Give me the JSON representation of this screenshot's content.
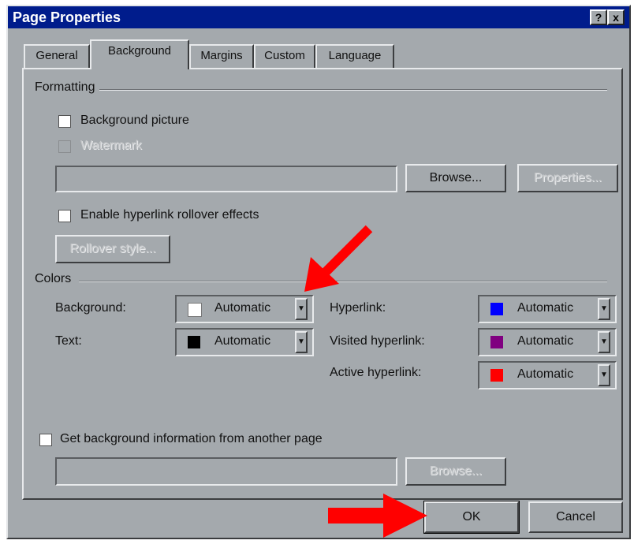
{
  "window": {
    "title": "Page Properties",
    "help_label": "?",
    "close_label": "x"
  },
  "tabs": [
    {
      "label": "General",
      "active": false
    },
    {
      "label": "Background",
      "active": true
    },
    {
      "label": "Margins",
      "active": false
    },
    {
      "label": "Custom",
      "active": false
    },
    {
      "label": "Language",
      "active": false
    }
  ],
  "formatting": {
    "group_label": "Formatting",
    "background_picture": {
      "label": "Background picture",
      "checked": false
    },
    "watermark": {
      "label": "Watermark",
      "checked": false,
      "disabled": true
    },
    "picture_path": "",
    "browse_label": "Browse...",
    "properties_label": "Properties...",
    "rollover": {
      "label": "Enable hyperlink rollover effects",
      "checked": false
    },
    "rollover_style_label": "Rollover style..."
  },
  "colors": {
    "group_label": "Colors",
    "background": {
      "label": "Background:",
      "value": "Automatic",
      "swatch": "#ffffff"
    },
    "text": {
      "label": "Text:",
      "value": "Automatic",
      "swatch": "#000000"
    },
    "hyperlink": {
      "label": "Hyperlink:",
      "value": "Automatic",
      "swatch": "#0000ff"
    },
    "visited": {
      "label": "Visited hyperlink:",
      "value": "Automatic",
      "swatch": "#800080"
    },
    "active": {
      "label": "Active hyperlink:",
      "value": "Automatic",
      "swatch": "#ff0000"
    }
  },
  "other_page": {
    "label": "Get background information from another page",
    "checked": false,
    "path": "",
    "browse_label": "Browse..."
  },
  "footer": {
    "ok_label": "OK",
    "cancel_label": "Cancel"
  },
  "annotation_color": "#ff0000"
}
